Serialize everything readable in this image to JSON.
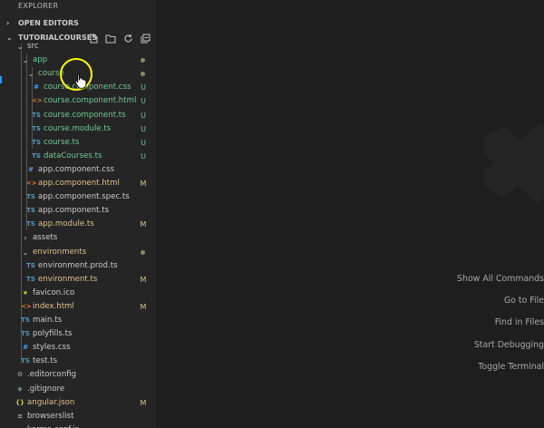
{
  "explorer": {
    "title": "EXPLORER",
    "sections": {
      "open_editors": {
        "label": "OPEN EDITORS",
        "expanded": false
      },
      "workspace": {
        "label": "TUTORIALCOURSES",
        "expanded": true
      }
    },
    "actions": [
      "new-file-icon",
      "new-folder-icon",
      "refresh-icon",
      "collapse-all-icon"
    ]
  },
  "tree": [
    {
      "name": "src",
      "type": "folder",
      "expanded": true,
      "depth": 1,
      "status": "",
      "color": "default"
    },
    {
      "name": "app",
      "type": "folder",
      "expanded": true,
      "depth": 2,
      "status": "dot",
      "color": "green"
    },
    {
      "name": "course",
      "type": "folder",
      "expanded": true,
      "depth": 3,
      "status": "dot",
      "color": "green"
    },
    {
      "name": "course.component.css",
      "type": "css",
      "depth": 4,
      "status": "U",
      "color": "green"
    },
    {
      "name": "course.component.html",
      "type": "html",
      "depth": 4,
      "status": "U",
      "color": "green"
    },
    {
      "name": "course.component.ts",
      "type": "ts",
      "depth": 4,
      "status": "U",
      "color": "green"
    },
    {
      "name": "course.module.ts",
      "type": "ts",
      "depth": 4,
      "status": "U",
      "color": "green"
    },
    {
      "name": "course.ts",
      "type": "ts",
      "depth": 4,
      "status": "U",
      "color": "green"
    },
    {
      "name": "dataCourses.ts",
      "type": "ts",
      "depth": 4,
      "status": "U",
      "color": "green"
    },
    {
      "name": "app.component.css",
      "type": "css",
      "depth": 3,
      "status": "",
      "color": "default"
    },
    {
      "name": "app.component.html",
      "type": "html",
      "depth": 3,
      "status": "M",
      "color": "yellow"
    },
    {
      "name": "app.component.spec.ts",
      "type": "ts",
      "depth": 3,
      "status": "",
      "color": "default"
    },
    {
      "name": "app.component.ts",
      "type": "ts",
      "depth": 3,
      "status": "",
      "color": "default"
    },
    {
      "name": "app.module.ts",
      "type": "ts",
      "depth": 3,
      "status": "M",
      "color": "yellow"
    },
    {
      "name": "assets",
      "type": "folder",
      "expanded": false,
      "depth": 2,
      "status": "",
      "color": "default"
    },
    {
      "name": "environments",
      "type": "folder",
      "expanded": true,
      "depth": 2,
      "status": "dot",
      "color": "yellow"
    },
    {
      "name": "environment.prod.ts",
      "type": "ts",
      "depth": 3,
      "status": "",
      "color": "default"
    },
    {
      "name": "environment.ts",
      "type": "ts",
      "depth": 3,
      "status": "M",
      "color": "yellow"
    },
    {
      "name": "favicon.ico",
      "type": "star",
      "depth": 2,
      "status": "",
      "color": "default"
    },
    {
      "name": "index.html",
      "type": "html",
      "depth": 2,
      "status": "M",
      "color": "yellow"
    },
    {
      "name": "main.ts",
      "type": "ts",
      "depth": 2,
      "status": "",
      "color": "default"
    },
    {
      "name": "polyfills.ts",
      "type": "ts",
      "depth": 2,
      "status": "",
      "color": "default"
    },
    {
      "name": "styles.css",
      "type": "css",
      "depth": 2,
      "status": "",
      "color": "default"
    },
    {
      "name": "test.ts",
      "type": "ts",
      "depth": 2,
      "status": "",
      "color": "default"
    },
    {
      "name": ".editorconfig",
      "type": "gear",
      "depth": 1,
      "status": "",
      "color": "default"
    },
    {
      "name": ".gitignore",
      "type": "git",
      "depth": 1,
      "status": "",
      "color": "default"
    },
    {
      "name": "angular.json",
      "type": "json",
      "depth": 1,
      "status": "M",
      "color": "yellow"
    },
    {
      "name": "browserslist",
      "type": "list",
      "depth": 1,
      "status": "",
      "color": "default"
    },
    {
      "name": "karma.conf.js",
      "type": "karma",
      "depth": 1,
      "status": "",
      "color": "default"
    }
  ],
  "icons": {
    "ts": "TS",
    "css": "#",
    "html": "<>",
    "json": "{}",
    "star": "★",
    "gear": "⚙",
    "git": "◆",
    "list": "≡",
    "karma": "≡"
  },
  "editor": {
    "shortcuts": [
      {
        "label": "Show All Commands"
      },
      {
        "label": "Go to File"
      },
      {
        "label": "Find in Files"
      },
      {
        "label": "Start Debugging"
      },
      {
        "label": "Toggle Terminal"
      }
    ]
  },
  "colors": {
    "untracked": "#73c991",
    "modified": "#e2c08d",
    "sidebar_bg": "#252526",
    "editor_bg": "#1e1e1e",
    "cursor_highlight": "#ffff00"
  }
}
